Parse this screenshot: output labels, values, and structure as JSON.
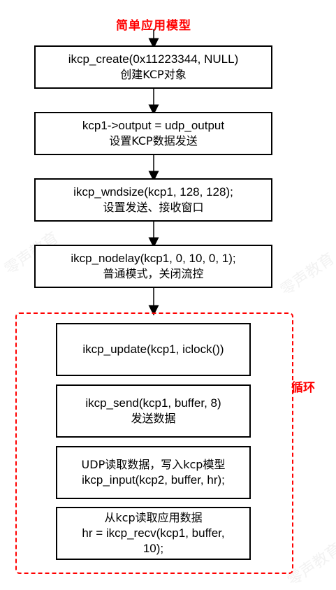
{
  "title": "简单应用模型",
  "steps": [
    {
      "line1": "ikcp_create(0x11223344, NULL)",
      "line2": "创建KCP对象"
    },
    {
      "line1": "kcp1->output = udp_output",
      "line2": "设置KCP数据发送"
    },
    {
      "line1": "ikcp_wndsize(kcp1, 128, 128);",
      "line2": "设置发送、接收窗口"
    },
    {
      "line1": "ikcp_nodelay(kcp1, 0, 10, 0, 1);",
      "line2": "普通模式，关闭流控"
    }
  ],
  "loop": {
    "label": "循环",
    "steps": [
      {
        "line1": "ikcp_update(kcp1, iclock())",
        "line2": ""
      },
      {
        "line1": "ikcp_send(kcp1, buffer, 8)",
        "line2": "发送数据"
      },
      {
        "line1": "UDP读取数据，写入kcp模型",
        "line2": "ikcp_input(kcp2, buffer, hr);"
      },
      {
        "line1": "从kcp读取应用数据",
        "line2": "hr = ikcp_recv(kcp1, buffer,",
        "line3": "10);"
      }
    ]
  },
  "colors": {
    "accent": "#ff0000",
    "border": "#000000",
    "background": "#ffffff"
  },
  "watermark": "零声教育"
}
